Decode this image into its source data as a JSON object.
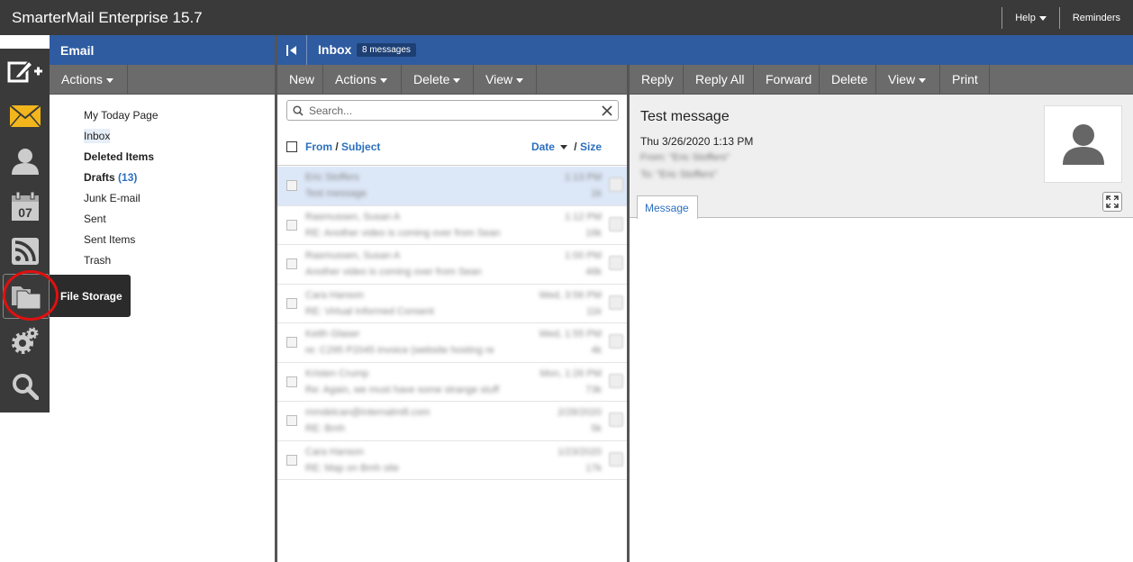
{
  "app": {
    "title": "SmarterMail Enterprise 15.7"
  },
  "top_links": {
    "help": "Help",
    "reminders": "Reminders"
  },
  "rail": {
    "items": [
      {
        "name": "compose-icon"
      },
      {
        "name": "email-icon"
      },
      {
        "name": "contacts-icon"
      },
      {
        "name": "calendar-icon",
        "day": "07"
      },
      {
        "name": "rss-icon"
      },
      {
        "name": "file-storage-icon"
      },
      {
        "name": "settings-icon"
      },
      {
        "name": "search-icon"
      }
    ],
    "tooltip": "File Storage",
    "highlight_color": "#e01010"
  },
  "folders_panel": {
    "title": "Email",
    "actions_label": "Actions",
    "folders": [
      {
        "label": "My Today Page"
      },
      {
        "label": "Inbox"
      },
      {
        "label": "Deleted Items"
      },
      {
        "label": "Drafts",
        "count": "(13)"
      },
      {
        "label": "Junk E-mail"
      },
      {
        "label": "Sent"
      },
      {
        "label": "Sent Items"
      },
      {
        "label": "Trash"
      }
    ]
  },
  "inbox": {
    "title": "Inbox",
    "badge": "8 messages",
    "toolbar": {
      "new": "New",
      "actions": "Actions",
      "delete": "Delete",
      "view": "View"
    },
    "search_placeholder": "Search...",
    "header": {
      "from": "From",
      "sep": " / ",
      "subject": "Subject",
      "date": "Date",
      "size_sep": " / ",
      "size": "Size"
    },
    "messages": [
      {
        "from": "Eric Stoffers",
        "subject": "Test message",
        "date": "1:13 PM",
        "size": "1k"
      },
      {
        "from": "Rasmussen, Susan A",
        "subject": "RE: Another video is coming over from Sean",
        "date": "1:12 PM",
        "size": "16k"
      },
      {
        "from": "Rasmussen, Susan A",
        "subject": "Another video is coming over from Sean",
        "date": "1:00 PM",
        "size": "46k"
      },
      {
        "from": "Cara Hanson",
        "subject": "RE: Virtual Informed Consent",
        "date": "Wed, 3:56 PM",
        "size": "11k"
      },
      {
        "from": "Keith Glaser",
        "subject": "re: C295 P2045 invoice (website hosting re",
        "date": "Wed, 1:55 PM",
        "size": "4k"
      },
      {
        "from": "Kristen Crump",
        "subject": "Re: Again, we must have some strange stuff",
        "date": "Mon, 1:26 PM",
        "size": "73k"
      },
      {
        "from": "mmdelcan@internalmill.com",
        "subject": "RE: Bmh",
        "date": "2/28/2020",
        "size": "5k"
      },
      {
        "from": "Cara Hanson",
        "subject": "RE: Map on Bmh site",
        "date": "1/23/2020",
        "size": "17k"
      }
    ]
  },
  "reader": {
    "toolbar": {
      "reply": "Reply",
      "reply_all": "Reply All",
      "forward": "Forward",
      "delete": "Delete",
      "view": "View",
      "print": "Print"
    },
    "subject": "Test message",
    "date": "Thu 3/26/2020 1:13 PM",
    "from_line": "From: \"Eric Stoffers\"",
    "to_line": "To: \"Eric Stoffers\"",
    "tab": "Message"
  }
}
